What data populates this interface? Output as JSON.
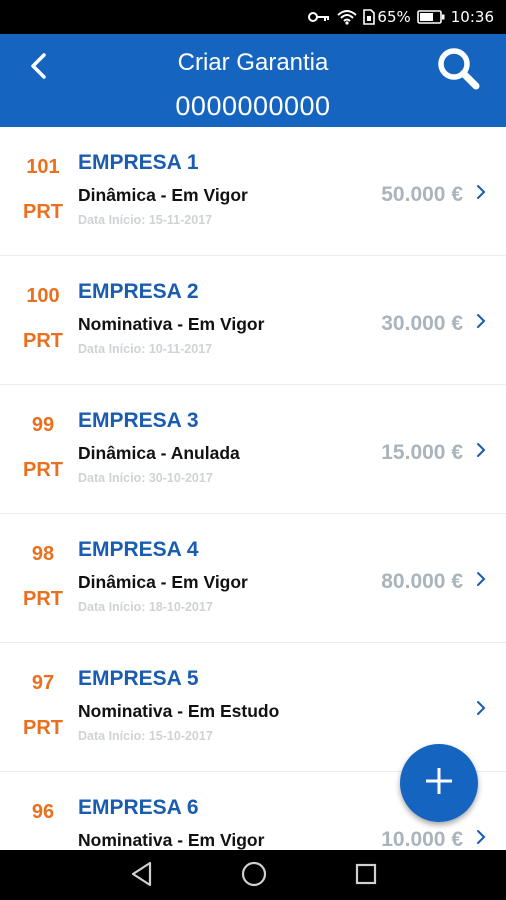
{
  "status_bar": {
    "battery": "65%",
    "time": "10:36",
    "icons": [
      "key-icon",
      "wifi-icon",
      "sim-icon",
      "battery-icon"
    ]
  },
  "header": {
    "title": "Criar Garantia",
    "subtitle": "0000000000",
    "back_icon": "chevron-left-icon",
    "search_icon": "search-icon"
  },
  "guarantees": [
    {
      "number": "101",
      "country": "PRT",
      "company": "EMPRESA 1",
      "type_status": "Dinâmica - Em Vigor",
      "start_date": "Data Início: 15-11-2017",
      "amount": "50.000 €"
    },
    {
      "number": "100",
      "country": "PRT",
      "company": "EMPRESA 2",
      "type_status": "Nominativa - Em Vigor",
      "start_date": "Data Início: 10-11-2017",
      "amount": "30.000 €"
    },
    {
      "number": "99",
      "country": "PRT",
      "company": "EMPRESA 3",
      "type_status": "Dinâmica - Anulada",
      "start_date": "Data Início: 30-10-2017",
      "amount": "15.000 €"
    },
    {
      "number": "98",
      "country": "PRT",
      "company": "EMPRESA 4",
      "type_status": "Dinâmica - Em Vigor",
      "start_date": "Data Início: 18-10-2017",
      "amount": "80.000 €"
    },
    {
      "number": "97",
      "country": "PRT",
      "company": "EMPRESA 5",
      "type_status": "Nominativa - Em Estudo",
      "start_date": "Data Início: 15-10-2017",
      "amount": ""
    },
    {
      "number": "96",
      "country": "",
      "company": "EMPRESA 6",
      "type_status": "Nominativa - Em Vigor",
      "start_date": "",
      "amount": "10.000 €"
    }
  ],
  "fab": {
    "icon": "plus-icon"
  },
  "nav_bar": {
    "icons": [
      "back-triangle-icon",
      "home-circle-icon",
      "recents-square-icon"
    ]
  },
  "colors": {
    "primary": "#1565c0",
    "accent_orange": "#e8701e",
    "company_blue": "#1a5cb0",
    "amount_gray": "#a9b4bc",
    "date_gray": "#cfd3d6"
  }
}
